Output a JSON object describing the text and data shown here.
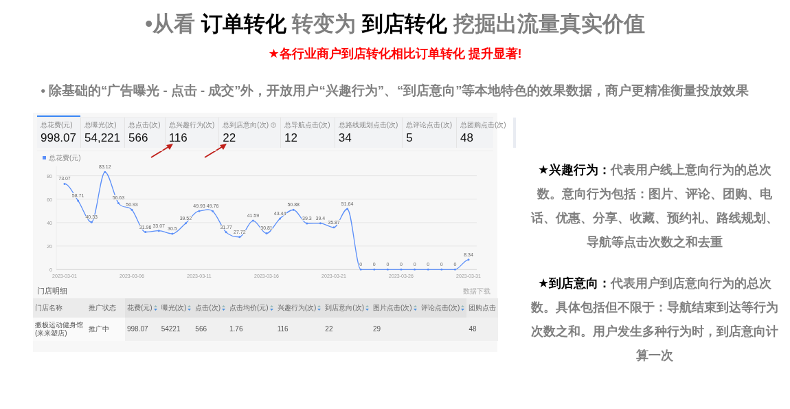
{
  "header": {
    "title_segments": [
      {
        "text": "•从看 ",
        "emphasis": false
      },
      {
        "text": "订单转化",
        "emphasis": true
      },
      {
        "text": " 转变为 ",
        "emphasis": false
      },
      {
        "text": "到店转化",
        "emphasis": true
      },
      {
        "text": " 挖掘出流量真实价值",
        "emphasis": false
      }
    ],
    "subtitle": "★各行业商户到店转化相比订单转化 提升显著!",
    "bullet": "• 除基础的“广告曝光 - 点击 - 成交”外，开放用户“兴趣行为”、“到店意向”等本地特色的效果数据，商户更精准衡量投放效果"
  },
  "dashboard": {
    "metrics": [
      {
        "label": "总花费(元)",
        "value": "998.07",
        "selected": true,
        "help": false,
        "highlighted": false
      },
      {
        "label": "总曝光(次)",
        "value": "54,221",
        "selected": false,
        "help": false,
        "highlighted": false
      },
      {
        "label": "总点击(次)",
        "value": "566",
        "selected": false,
        "help": false,
        "highlighted": false
      },
      {
        "label": "总兴趣行为(次)",
        "value": "116",
        "selected": false,
        "help": false,
        "highlighted": true
      },
      {
        "label": "总到店意向(次)",
        "value": "22",
        "selected": false,
        "help": true,
        "highlighted": true
      },
      {
        "label": "总导航点击(次)",
        "value": "12",
        "selected": false,
        "help": false,
        "highlighted": false
      },
      {
        "label": "总路线规划点击(次)",
        "value": "34",
        "selected": false,
        "help": false,
        "highlighted": false
      },
      {
        "label": "总评论点击(次)",
        "value": "5",
        "selected": false,
        "help": false,
        "highlighted": false
      },
      {
        "label": "总团购点击(次)",
        "value": "48",
        "selected": false,
        "help": false,
        "highlighted": false
      }
    ],
    "chart_data": {
      "type": "line",
      "categories": [
        "2023-03-01",
        null,
        null,
        null,
        null,
        "2023-03-06",
        null,
        null,
        null,
        null,
        "2023-03-11",
        null,
        null,
        null,
        null,
        "2023-03-16",
        null,
        null,
        null,
        null,
        "2023-03-21",
        null,
        null,
        null,
        null,
        "2023-03-26",
        null,
        null,
        null,
        null,
        "2023-03-31"
      ],
      "series": [
        {
          "name": "总花费(元)",
          "color": "#5b8ff9",
          "values": [
            73.07,
            58.71,
            40.33,
            83.12,
            56.63,
            50.93,
            31.96,
            33.07,
            30.5,
            39.52,
            49.93,
            49.76,
            31.77,
            27.72,
            41.59,
            30.81,
            43.44,
            50.88,
            39.3,
            39.4,
            35.87,
            51.64,
            0,
            0,
            0,
            0,
            0,
            0,
            0,
            0,
            8.34
          ]
        }
      ],
      "value_labels": [
        "73.07",
        "58.71",
        "40.33",
        "83.12",
        "56.63",
        "50.93",
        "31.96",
        "33.07",
        "30.5",
        "39.52",
        "49.93",
        "49.76",
        "31.77",
        "27.72",
        "41.59",
        "30.81",
        "43.44",
        "50.88",
        "39.3",
        "39.4",
        "35.87",
        "51.64",
        "0",
        "0",
        "0",
        "0",
        "0",
        "0",
        "0",
        "0",
        "8.34"
      ],
      "yticks": [
        0,
        20,
        40,
        60,
        80
      ],
      "ylim": [
        0,
        88
      ],
      "grid": true
    },
    "table_title": "门店明细",
    "download_link": "数据下载",
    "table": {
      "columns": [
        {
          "label": "门店名称",
          "sortable": false
        },
        {
          "label": "推广状态",
          "sortable": false
        },
        {
          "label": "花费(元)",
          "sortable": true
        },
        {
          "label": "曝光(次)",
          "sortable": true
        },
        {
          "label": "点击(次)",
          "sortable": true
        },
        {
          "label": "点击均价(元)",
          "sortable": true
        },
        {
          "label": "兴趣行为(次)",
          "sortable": true
        },
        {
          "label": "到店意向(次)",
          "sortable": true
        },
        {
          "label": "图片点击(次)",
          "sortable": true
        },
        {
          "label": "评论点击(次)",
          "sortable": true
        },
        {
          "label": "团购点击",
          "sortable": false
        }
      ],
      "rows": [
        {
          "cells": [
            "搬极运动健身馆(来来塑店)",
            "推广中",
            "998.07",
            "54221",
            "566",
            "1.76",
            "116",
            "22",
            "29",
            null,
            "48"
          ]
        }
      ]
    }
  },
  "notes": [
    {
      "label": "★兴趣行为：",
      "text": "代表用户线上意向行为的总次数。意向行为包括：图片、评论、团购、电话、优惠、分享、收藏、预约礼、路线规划、导航等点击次数之和去重"
    },
    {
      "label": "★到店意向：",
      "text": "代表用户到店意向行为的总次数。具体包括但不限于：导航结束到达等行为次数之和。用户发生多种行为时，到店意向计算一次"
    }
  ]
}
